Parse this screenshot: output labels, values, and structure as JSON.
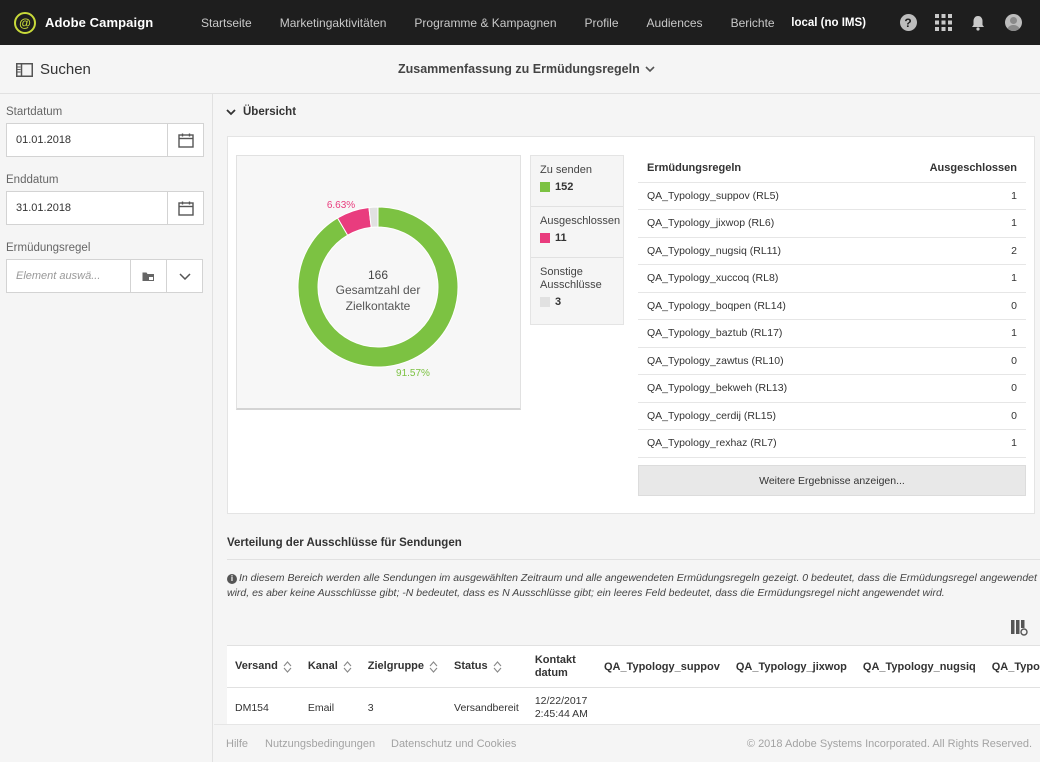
{
  "app": {
    "name": "Adobe Campaign",
    "logo_letter": "@"
  },
  "nav": [
    "Startseite",
    "Marketingaktivitäten",
    "Programme & Kampagnen",
    "Profile",
    "Audiences",
    "Berichte"
  ],
  "topbar": {
    "instance": "local (no IMS)",
    "help": "?"
  },
  "header": {
    "search_label": "Suchen",
    "title": "Zusammenfassung zu Ermüdungsregeln"
  },
  "filters": {
    "start_label": "Startdatum",
    "start_value": "01.01.2018",
    "end_label": "Enddatum",
    "end_value": "31.01.2018",
    "rule_label": "Ermüdungsregel",
    "rule_placeholder": "Element auswä..."
  },
  "overview": {
    "title": "Übersicht",
    "total": "166",
    "total_label_1": "Gesamtzahl der",
    "total_label_2": "Zielkontakte",
    "pct_green": "91.57%",
    "pct_pink": "6.63%",
    "legend": [
      {
        "label": "Zu senden",
        "value": "152",
        "color": "#7cc242"
      },
      {
        "label": "Ausgeschlossen",
        "value": "11",
        "color": "#e93c7e"
      },
      {
        "label": "Sonstige Ausschlüsse",
        "value": "3",
        "color": "#e1e1e1"
      }
    ]
  },
  "chart_data": {
    "type": "pie",
    "categories": [
      "Zu senden",
      "Ausgeschlossen",
      "Sonstige Ausschlüsse"
    ],
    "values": [
      152,
      11,
      3
    ],
    "colors": [
      "#7cc242",
      "#e93c7e",
      "#e1e1e1"
    ],
    "center_text": "166 Gesamtzahl der Zielkontakte",
    "data_labels": [
      "91.57%",
      "6.63%",
      ""
    ]
  },
  "rules_table": {
    "col_rule": "Ermüdungsregeln",
    "col_excluded": "Ausgeschlossen",
    "rows": [
      {
        "name": "QA_Typology_suppov (RL5)",
        "value": "1"
      },
      {
        "name": "QA_Typology_jixwop (RL6)",
        "value": "1"
      },
      {
        "name": "QA_Typology_nugsiq (RL11)",
        "value": "2"
      },
      {
        "name": "QA_Typology_xuccoq (RL8)",
        "value": "1"
      },
      {
        "name": "QA_Typology_boqpen (RL14)",
        "value": "0"
      },
      {
        "name": "QA_Typology_baztub (RL17)",
        "value": "1"
      },
      {
        "name": "QA_Typology_zawtus (RL10)",
        "value": "0"
      },
      {
        "name": "QA_Typology_bekweh (RL13)",
        "value": "0"
      },
      {
        "name": "QA_Typology_cerdij (RL15)",
        "value": "0"
      },
      {
        "name": "QA_Typology_rexhaz (RL7)",
        "value": "1"
      }
    ],
    "more_label": "Weitere Ergebnisse anzeigen..."
  },
  "distribution": {
    "title": "Verteilung der Ausschlüsse für Sendungen",
    "info": "In diesem Bereich werden alle Sendungen im ausgewählten Zeitraum und alle angewendeten Ermüdungsregeln gezeigt. 0 bedeutet, dass die Ermüdungsregel angewendet wird, es aber keine Ausschlüsse gibt; -N bedeutet, dass es N Ausschlüsse gibt; ein leeres Feld bedeutet, dass die Ermüdungsregel nicht angewendet wird.",
    "columns": [
      "Versand",
      "Kanal",
      "Zielgruppe",
      "Status",
      "Kontakt datum",
      "QA_Typology_suppov",
      "QA_Typology_jixwop",
      "QA_Typology_nugsiq",
      "QA_Typology_xu"
    ],
    "rows": [
      {
        "versand": "DM154",
        "kanal": "Email",
        "zielgruppe": "3",
        "status": "Versandbereit",
        "datum_1": "12/22/2017",
        "datum_2": "2:45:44 AM"
      }
    ]
  },
  "footer": {
    "help": "Hilfe",
    "terms": "Nutzungsbedingungen",
    "privacy": "Datenschutz und Cookies",
    "copyright": "© 2018 Adobe Systems Incorporated. All Rights Reserved."
  }
}
